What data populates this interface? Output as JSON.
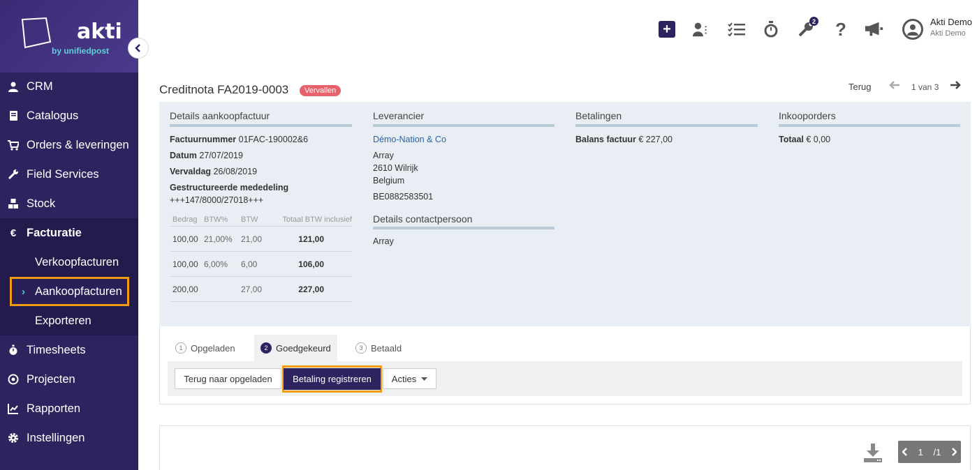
{
  "logo": {
    "brand": "akti",
    "by": "by unifiedpost"
  },
  "sidebar": {
    "items": [
      {
        "label": "CRM",
        "icon": "user-icon"
      },
      {
        "label": "Catalogus",
        "icon": "book-icon"
      },
      {
        "label": "Orders & leveringen",
        "icon": "cart-icon"
      },
      {
        "label": "Field Services",
        "icon": "wrench-icon"
      },
      {
        "label": "Stock",
        "icon": "cubes-icon"
      },
      {
        "label": "Facturatie",
        "icon": "euro-icon"
      },
      {
        "label": "Timesheets",
        "icon": "stopwatch-icon"
      },
      {
        "label": "Projecten",
        "icon": "target-icon"
      },
      {
        "label": "Rapporten",
        "icon": "chart-icon"
      },
      {
        "label": "Instellingen",
        "icon": "gear-icon"
      }
    ],
    "subitems": [
      "Verkoopfacturen",
      "Aankoopfacturen",
      "Exporteren"
    ],
    "euro_symbol": "€",
    "active_chevron": "›"
  },
  "topbar": {
    "plus": "+",
    "help": "?",
    "wrench_badge": "2",
    "user_name": "Akti Demo",
    "company": "Akti Demo"
  },
  "page": {
    "title": "Creditnota FA2019-0003",
    "status": "Vervallen",
    "status_color": "#e8626b",
    "back": "Terug",
    "pager": "1 van 3"
  },
  "details": {
    "heading": "Details aankoopfactuur",
    "invoice_label": "Factuurnummer",
    "invoice_value": "01FAC-190002&6",
    "date_label": "Datum",
    "date_value": "27/07/2019",
    "due_label": "Vervaldag",
    "due_value": "26/08/2019",
    "ref_label": "Gestructureerde mededeling",
    "ref_value": "+++147/8000/27018+++",
    "vat_headers": [
      "Bedrag",
      "BTW%",
      "BTW",
      "Totaal BTW inclusief"
    ],
    "vat_rows": [
      [
        "100,00",
        "21,00%",
        "21,00",
        "121,00"
      ],
      [
        "100,00",
        "6,00%",
        "6,00",
        "106,00"
      ],
      [
        "200,00",
        "",
        "27,00",
        "227,00"
      ]
    ]
  },
  "supplier": {
    "heading": "Leverancier",
    "name": "Démo-Nation & Co",
    "street": "Array",
    "city": "2610 Wilrijk",
    "country": "Belgium",
    "vat": "BE0882583501",
    "contact_heading": "Details contactpersoon",
    "contact": "Array"
  },
  "payments": {
    "heading": "Betalingen",
    "balance_label": "Balans factuur",
    "balance_value": "€ 227,00"
  },
  "purchase_orders": {
    "heading": "Inkooporders",
    "total_label": "Totaal",
    "total_value": "€ 0,00"
  },
  "workflow": {
    "steps": [
      {
        "num": "1",
        "label": "Opgeladen"
      },
      {
        "num": "2",
        "label": "Goedgekeurd"
      },
      {
        "num": "3",
        "label": "Betaald"
      }
    ],
    "back_button": "Terug naar opgeladen",
    "pay_button": "Betaling registreren",
    "actions_button": "Acties"
  },
  "document": {
    "page": "1",
    "total": "/1"
  },
  "colors": {
    "sidebar": "#2f235f",
    "accent_highlight": "#f39c12",
    "link": "#2a63a8"
  }
}
